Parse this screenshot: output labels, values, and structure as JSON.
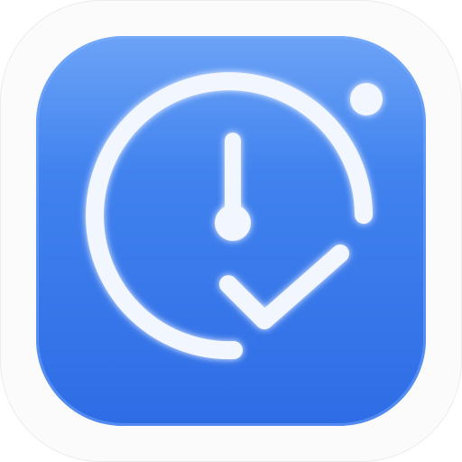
{
  "app_icon": {
    "name": "clock-checkmark-app-icon",
    "icon": "clock-with-checkmark-icon",
    "colors": {
      "background_top": "#4a8df3",
      "background_bottom": "#2f6ee6",
      "glyph": "#f2f6ff",
      "glyph_glow": "#9cc3ff",
      "outer_plate": "#fbfbfc"
    }
  }
}
